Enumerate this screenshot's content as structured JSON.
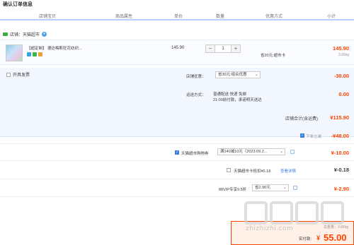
{
  "page_title": "确认订单信息",
  "columns": [
    "店铺宝贝",
    "商品属性",
    "单价",
    "数量",
    "优惠方式",
    "小计"
  ],
  "store": {
    "name": "店铺：天猫超市"
  },
  "item": {
    "title": "【超定制】 德达梅斯狂花纺织...",
    "unit_price": "145.90",
    "quantity": "1",
    "promo_note": "省20元:超市卡",
    "subtotal": "145.90",
    "weight": "3.66kg"
  },
  "options": {
    "invoice_label": "开具发票",
    "discount_label": "店铺优惠：",
    "discount_select": "省30元:组合优惠",
    "discount_value": "-30.00",
    "shipping_label": "运送方式：",
    "shipping_line1": "普通配送 快递 免邮",
    "shipping_line2": "21:00前付款，承诺明天送达",
    "shipping_value": "0.00",
    "store_total_label": "店铺合计(含运费)",
    "store_total_value": "¥115.90"
  },
  "rows": {
    "r1_label": "下单立减",
    "r1_value": "-¥48.00",
    "r2_label": "天猫超市购物券",
    "r2_select": "满140减10元（2023.09.2...",
    "r2_value": "¥-10.00",
    "r3_label": "天猫超市卡抵扣¥0.18",
    "r3_link": "查看详情",
    "r3_value": "¥-0.18",
    "r4_label": "88VIP专享9.5折",
    "r4_select": "省2.90元",
    "r4_value": "¥-2.90"
  },
  "summary": {
    "weight": "总重量：3.66kg",
    "label": "实付款:",
    "currency": "¥",
    "amount": "55.00"
  },
  "watermark": {
    "text": "zhizhizhi.com"
  },
  "colors": {
    "price_red": "#ff4400",
    "link_blue": "#3b7ddd",
    "header_line": "#b2d1ff",
    "panel_bg": "#f2f7ff"
  }
}
